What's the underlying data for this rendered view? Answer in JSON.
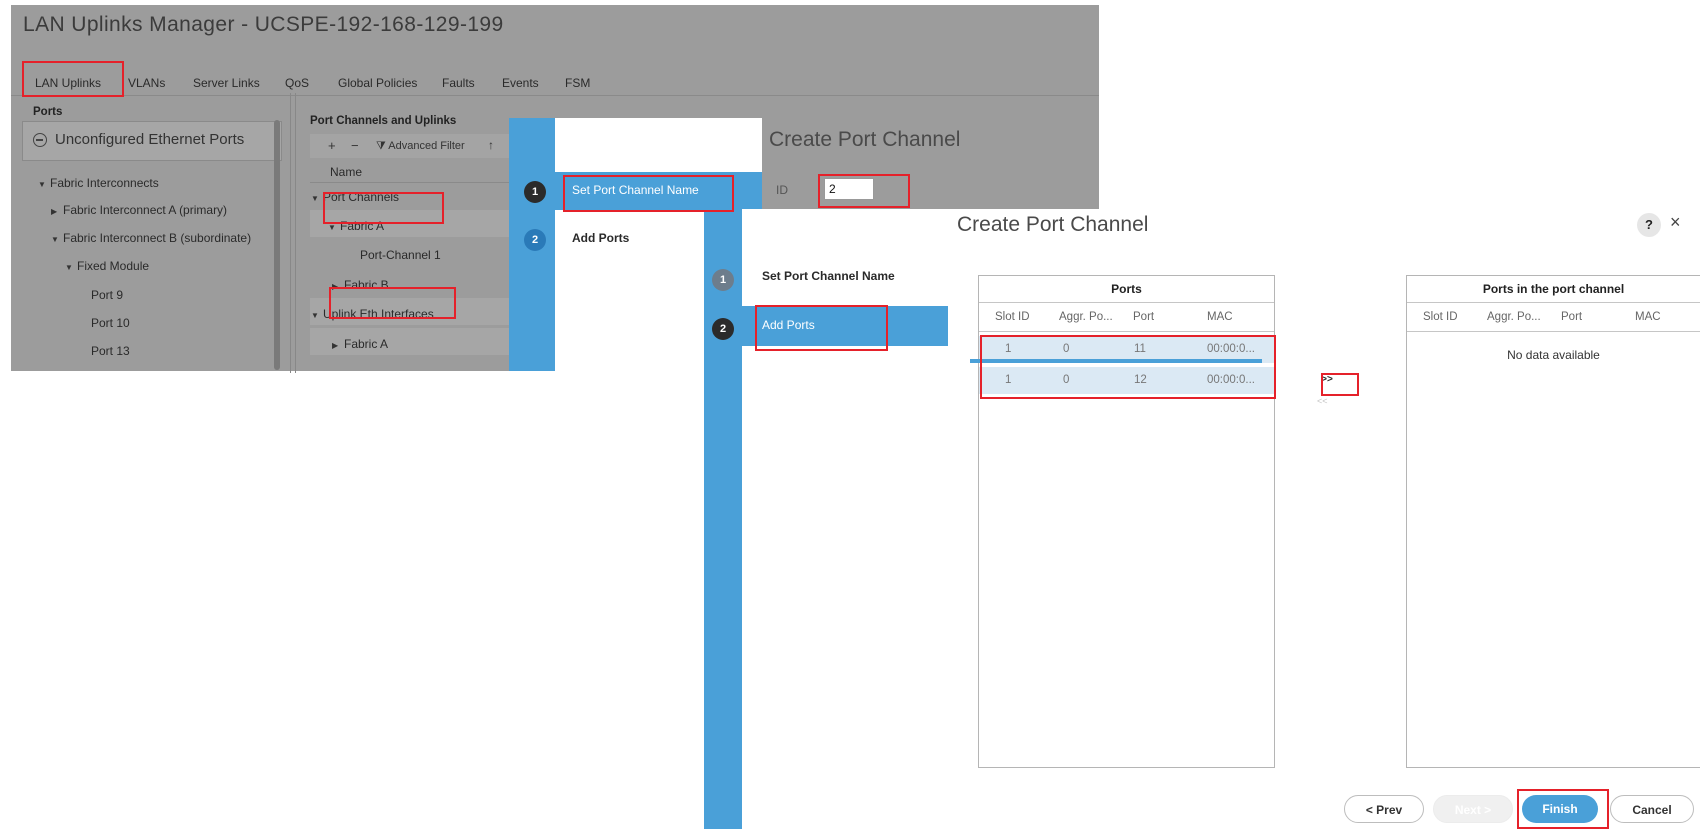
{
  "manager": {
    "title": "LAN Uplinks Manager - UCSPE-192-168-129-199",
    "tabs": [
      "LAN Uplinks",
      "VLANs",
      "Server Links",
      "QoS",
      "Global Policies",
      "Faults",
      "Events",
      "FSM"
    ],
    "left_pane": {
      "title": "Ports",
      "unconfigured": "Unconfigured Ethernet Ports",
      "tree": [
        {
          "label": "Fabric Interconnects",
          "toggle": "expanded"
        },
        {
          "label": "Fabric Interconnect A (primary)",
          "toggle": "collapsed"
        },
        {
          "label": "Fabric Interconnect B (subordinate)",
          "toggle": "expanded"
        },
        {
          "label": "Fixed Module",
          "toggle": "expanded"
        },
        {
          "label": "Port 9",
          "toggle": ""
        },
        {
          "label": "Port 10",
          "toggle": ""
        },
        {
          "label": "Port 13",
          "toggle": ""
        }
      ]
    },
    "right_pane": {
      "title": "Port Channels and Uplinks",
      "toolbar": {
        "add": "+",
        "remove": "−",
        "filter_label": "Advanced Filter",
        "export": "↑"
      },
      "column": "Name",
      "tree": [
        {
          "label": "Port Channels",
          "toggle": "expanded"
        },
        {
          "label": "Fabric A",
          "toggle": "expanded"
        },
        {
          "label": "Port-Channel 1",
          "toggle": ""
        },
        {
          "label": "Fabric B",
          "toggle": "collapsed"
        },
        {
          "label": "Uplink Eth Interfaces",
          "toggle": "expanded"
        },
        {
          "label": "Fabric A",
          "toggle": "collapsed"
        }
      ]
    }
  },
  "dialog1": {
    "title": "Create Port Channel",
    "steps": [
      {
        "number": "1",
        "label": "Set Port Channel Name"
      },
      {
        "number": "2",
        "label": "Add Ports"
      }
    ],
    "id_label": "ID",
    "id_value": "2"
  },
  "dialog2": {
    "title": "Create Port Channel",
    "help": "?",
    "close": "×",
    "steps": [
      {
        "number": "1",
        "label": "Set Port Channel Name"
      },
      {
        "number": "2",
        "label": "Add Ports"
      }
    ],
    "ports_table": {
      "title": "Ports",
      "columns": [
        "Slot ID",
        "Aggr. Po...",
        "Port",
        "MAC"
      ],
      "rows": [
        [
          "1",
          "0",
          "11",
          "00:00:0..."
        ],
        [
          "1",
          "0",
          "12",
          "00:00:0..."
        ]
      ]
    },
    "move_right": ">>",
    "move_left": "<<",
    "channel_table": {
      "title": "Ports in the port channel",
      "columns": [
        "Slot ID",
        "Aggr. Po...",
        "Port",
        "MAC"
      ],
      "empty": "No data available"
    },
    "buttons": {
      "prev": "< Prev",
      "next": "Next >",
      "finish": "Finish",
      "cancel": "Cancel"
    }
  },
  "colors": {
    "accent": "#4aa0d8",
    "highlight": "#e5212a",
    "manager_bg": "#9c9c9c"
  }
}
